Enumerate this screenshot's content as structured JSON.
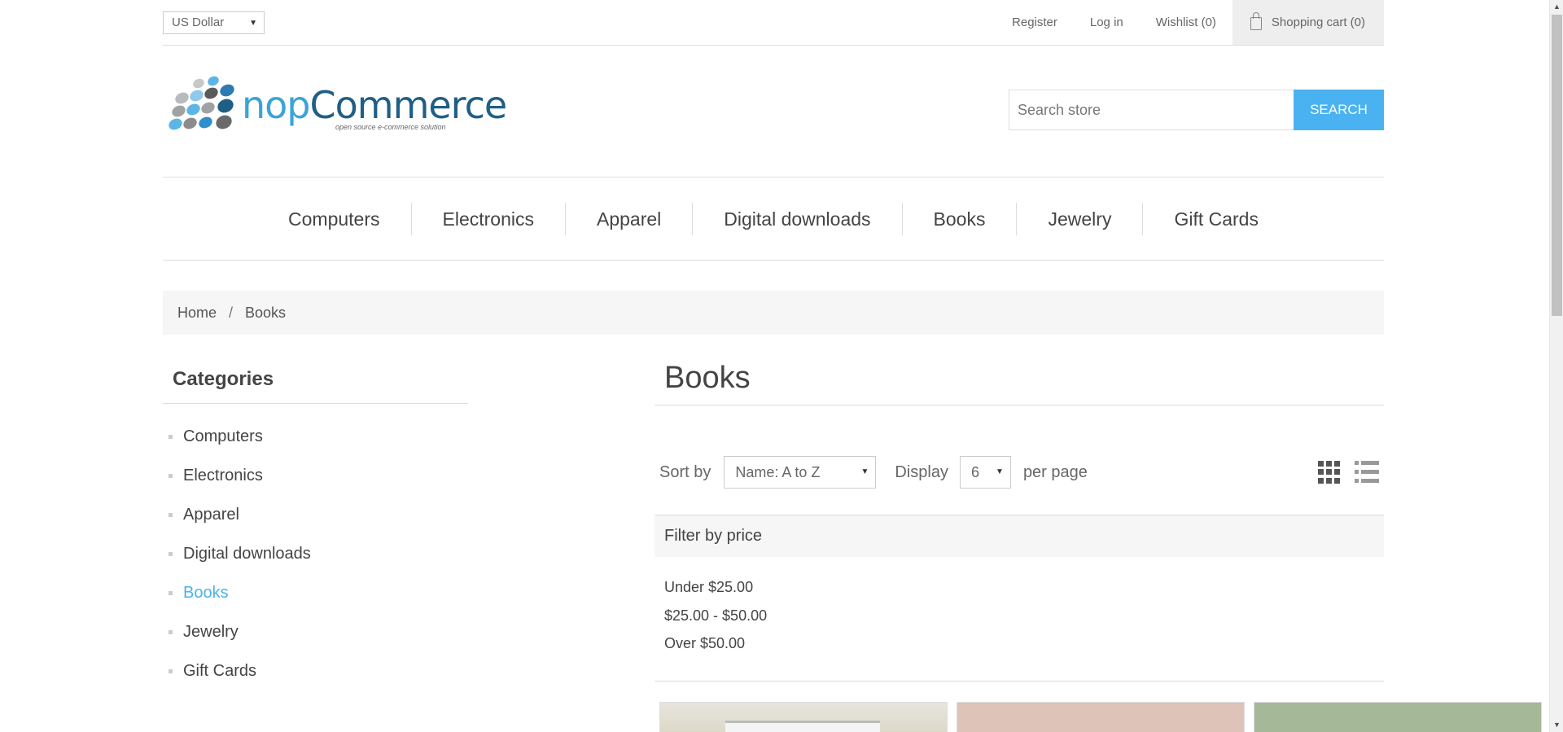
{
  "header": {
    "currency": "US Dollar",
    "links": {
      "register": "Register",
      "login": "Log in",
      "wishlist": "Wishlist (0)",
      "cart": "Shopping cart (0)"
    }
  },
  "logo": {
    "prefix": "nop",
    "suffix": "Commerce",
    "tagline": "open source e-commerce solution"
  },
  "search": {
    "placeholder": "Search store",
    "button": "SEARCH"
  },
  "topmenu": [
    "Computers",
    "Electronics",
    "Apparel",
    "Digital downloads",
    "Books",
    "Jewelry",
    "Gift Cards"
  ],
  "breadcrumb": {
    "home": "Home",
    "separator": "/",
    "current": "Books"
  },
  "sidebar": {
    "title": "Categories",
    "items": [
      "Computers",
      "Electronics",
      "Apparel",
      "Digital downloads",
      "Books",
      "Jewelry",
      "Gift Cards"
    ],
    "active": "Books"
  },
  "main": {
    "title": "Books",
    "sort_label": "Sort by",
    "sort_value": "Name: A to Z",
    "display_label": "Display",
    "display_value": "6",
    "per_page_label": "per page",
    "filter_title": "Filter by price",
    "filters": [
      "Under $25.00",
      "$25.00 - $50.00",
      "Over $50.00"
    ]
  },
  "colors": {
    "accent": "#4ab2f1",
    "text": "#444444"
  }
}
